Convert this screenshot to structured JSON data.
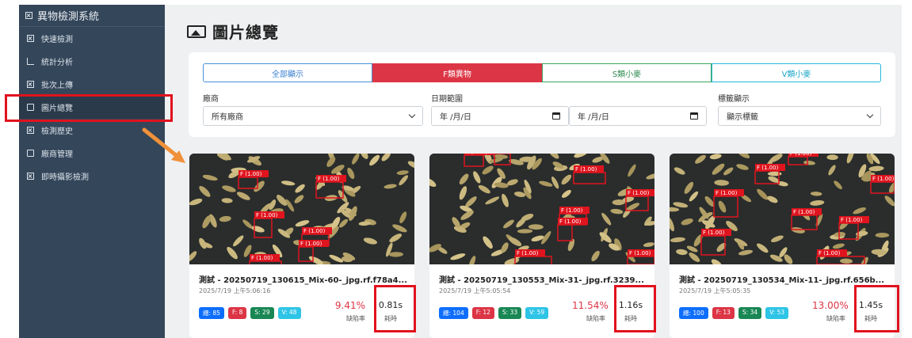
{
  "app": {
    "title": "異物檢測系統"
  },
  "sidebar": {
    "items": [
      {
        "label": "快速檢測",
        "icon": "x-box-icon"
      },
      {
        "label": "統計分析",
        "icon": "chart-icon"
      },
      {
        "label": "批次上傳",
        "icon": "x-box-icon"
      },
      {
        "label": "圖片總覽",
        "icon": "image-icon",
        "active": true
      },
      {
        "label": "檢測歷史",
        "icon": "x-box-icon"
      },
      {
        "label": "廠商管理",
        "icon": "store-icon"
      },
      {
        "label": "即時攝影檢測",
        "icon": "x-box-icon"
      }
    ]
  },
  "page": {
    "title": "圖片總覽"
  },
  "filters": {
    "tabs": [
      "全部顯示",
      "F類異物",
      "S類小麥",
      "V類小麥"
    ],
    "vendor": {
      "label": "廠商",
      "value": "所有廠商"
    },
    "date": {
      "label": "日期範圍",
      "start": "年 /月/日",
      "end": "年 /月/日"
    },
    "tag": {
      "label": "標籤顯示",
      "value": "顯示標籤"
    }
  },
  "detection_label": "F (1.00)",
  "cards": [
    {
      "name": "測試 - 20250719_130615_Mix-60-_jpg.rf.f78a4...",
      "time": "2025/7/19 上午5:06:16",
      "total": "總: 85",
      "f": "F: 8",
      "s": "S: 29",
      "v": "V: 48",
      "rate": "9.41%",
      "rate_label": "缺陷率",
      "duration": "0.81s",
      "duration_label": "耗時"
    },
    {
      "name": "測試 - 20250719_130553_Mix-31-_jpg.rf.3239...",
      "time": "2025/7/19 上午5:05:54",
      "total": "總: 104",
      "f": "F: 12",
      "s": "S: 33",
      "v": "V: 59",
      "rate": "11.54%",
      "rate_label": "缺陷率",
      "duration": "1.16s",
      "duration_label": "耗時"
    },
    {
      "name": "測試 - 20250719_130534_Mix-11-_jpg.rf.656b...",
      "time": "2025/7/19 上午5:05:35",
      "total": "總: 100",
      "f": "F: 13",
      "s": "S: 34",
      "v": "V: 53",
      "rate": "13.00%",
      "rate_label": "缺陷率",
      "duration": "1.45s",
      "duration_label": "耗時"
    }
  ]
}
